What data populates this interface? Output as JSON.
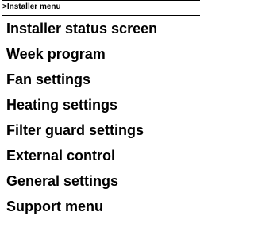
{
  "header": {
    "title": ">Installer menu"
  },
  "menu": {
    "items": [
      {
        "label": "Installer status screen"
      },
      {
        "label": "Week program"
      },
      {
        "label": "Fan settings"
      },
      {
        "label": "Heating settings"
      },
      {
        "label": "Filter guard settings"
      },
      {
        "label": "External control"
      },
      {
        "label": "General settings"
      },
      {
        "label": "Support menu"
      }
    ]
  }
}
